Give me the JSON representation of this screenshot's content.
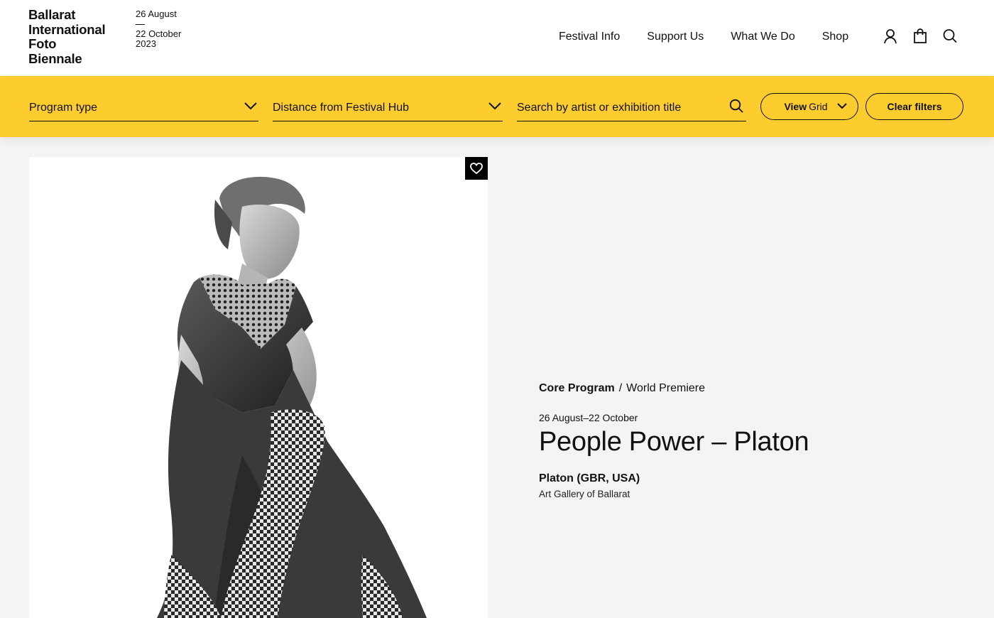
{
  "header": {
    "logo_lines": [
      "Ballarat",
      "International",
      "Foto",
      "Biennale"
    ],
    "date_start": "26 August",
    "date_end_day": "22 October",
    "date_end_year": "2023",
    "nav": [
      "Festival Info",
      "Support Us",
      "What We Do",
      "Shop"
    ],
    "icons": [
      "account-icon",
      "cart-icon",
      "search-icon"
    ]
  },
  "filters": {
    "program_type": "Program type",
    "distance": "Distance from Festival Hub",
    "search_placeholder": "Search by artist or exhibition title",
    "view_label": "View",
    "view_value": "Grid",
    "clear": "Clear filters"
  },
  "event": {
    "category": "Core Program",
    "separator": "/",
    "tag": "World Premiere",
    "dates": "26 August–22 October",
    "title": "People Power – Platon",
    "artist": "Platon (GBR, USA)",
    "venue": "Art Gallery of Ballarat",
    "image_alt": "Black and white portrait of a seated woman in a short-sleeved dress and patterned tights"
  },
  "colors": {
    "accent_yellow": "#fdcc2f",
    "background": "#f5f4f2",
    "text": "#111111"
  }
}
